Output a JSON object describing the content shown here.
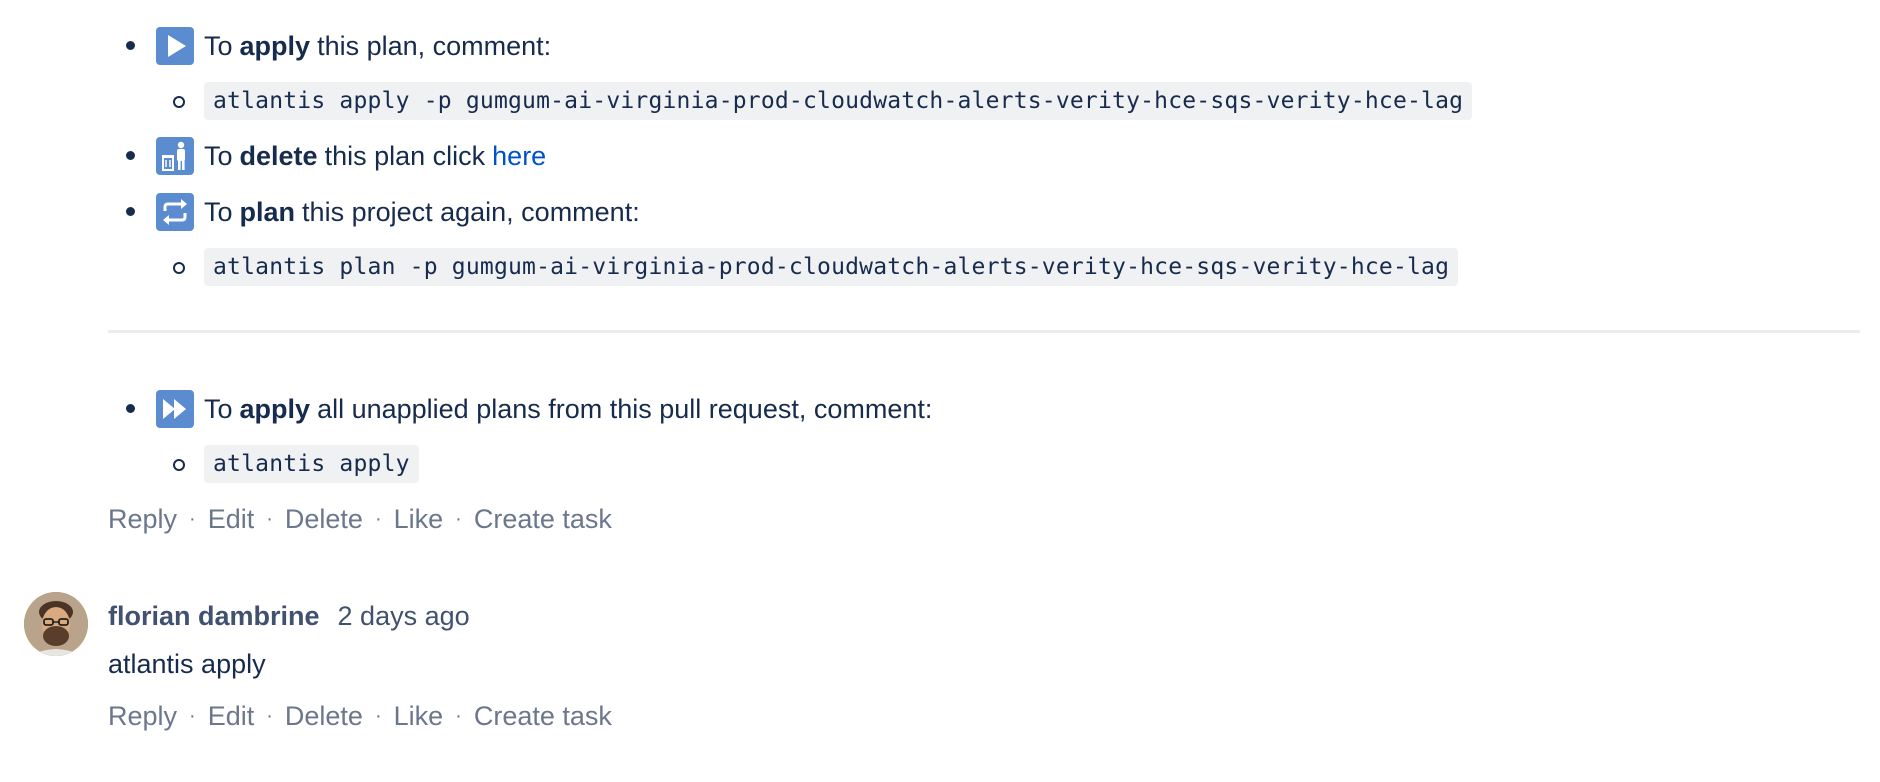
{
  "bullets": {
    "apply_plan": {
      "prefix": "To",
      "bold": "apply",
      "suffix": "this plan, comment:",
      "command": "atlantis apply -p gumgum-ai-virginia-prod-cloudwatch-alerts-verity-hce-sqs-verity-hce-lag"
    },
    "delete_plan": {
      "prefix": "To",
      "bold": "delete",
      "suffix": "this plan click",
      "link": "here"
    },
    "plan_again": {
      "prefix": "To",
      "bold": "plan",
      "suffix": "this project again, comment:",
      "command": "atlantis plan -p gumgum-ai-virginia-prod-cloudwatch-alerts-verity-hce-sqs-verity-hce-lag"
    },
    "apply_all": {
      "prefix": "To",
      "bold": "apply",
      "suffix": "all unapplied plans from this pull request, comment:",
      "command": "atlantis apply"
    }
  },
  "actions": {
    "reply": "Reply",
    "edit": "Edit",
    "delete": "Delete",
    "like": "Like",
    "create_task": "Create task",
    "separator": "·"
  },
  "comment": {
    "author": "florian dambrine",
    "time": "2 days ago",
    "text": "atlantis apply"
  },
  "colors": {
    "text": "#172B4D",
    "muted": "#6B778C",
    "link": "#0052CC",
    "emoji_bg": "#5B8CD0",
    "code_bg": "#F0F1F3"
  },
  "icons": [
    "play-button-icon",
    "litter-bin-icon",
    "repeat-icon",
    "fast-forward-icon"
  ]
}
